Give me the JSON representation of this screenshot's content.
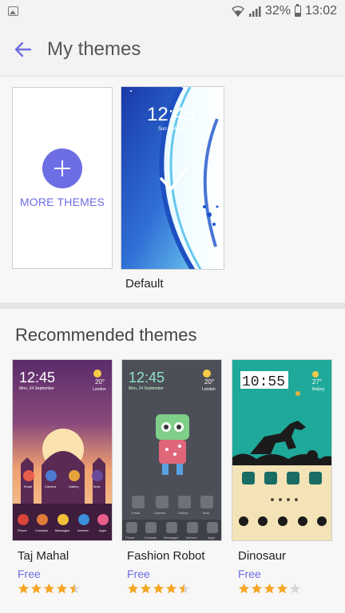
{
  "status_bar": {
    "battery": "32%",
    "time": "13:02"
  },
  "header": {
    "title": "My themes"
  },
  "my_themes": {
    "more_label": "MORE THEMES",
    "default_card": {
      "name": "Default",
      "clock": "12:45",
      "date": "Sun 1 March"
    }
  },
  "recommended": {
    "title": "Recommended themes",
    "items": [
      {
        "name": "Taj Mahal",
        "price": "Free",
        "rating": 4.5,
        "preview": {
          "clock": "12:45",
          "date": "Mon, 24 September",
          "temp": "20°",
          "city": "London",
          "icons": [
            "Email",
            "Camera",
            "Gallery",
            "Tools"
          ],
          "dock": [
            "Phone",
            "Contacts",
            "Messages",
            "Internet",
            "Apps"
          ]
        }
      },
      {
        "name": "Fashion Robot",
        "price": "Free",
        "rating": 4.5,
        "preview": {
          "clock": "12:45",
          "date": "Mon, 24 September",
          "temp": "20°",
          "city": "London",
          "icons": [
            "Email",
            "Camera",
            "Gallery",
            "Tools"
          ],
          "dock": [
            "Phone",
            "Contacts",
            "Messages",
            "Internet",
            "Apps"
          ]
        }
      },
      {
        "name": "Dinosaur",
        "price": "Free",
        "rating": 4.0,
        "preview": {
          "clock": "10:55",
          "temp": "27°",
          "city": "Beijing"
        }
      }
    ]
  },
  "colors": {
    "accent": "#6d6de4",
    "star": "#f5a623",
    "star_empty": "#d8d8d8"
  }
}
